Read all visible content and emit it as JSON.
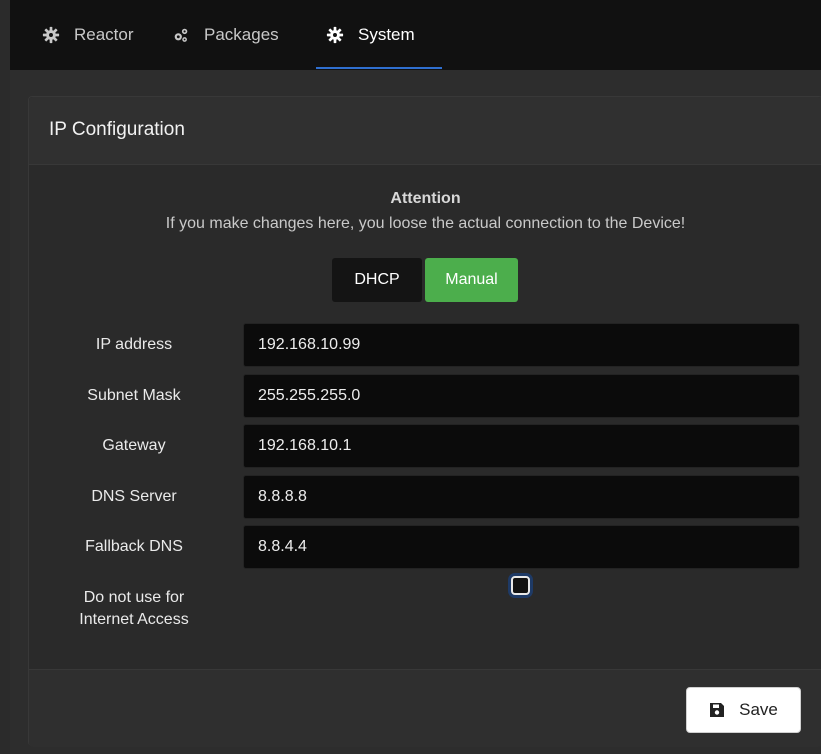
{
  "nav": {
    "tabs": [
      {
        "label": "Reactor",
        "icon": "cog-icon"
      },
      {
        "label": "Packages",
        "icon": "cogs-icon"
      },
      {
        "label": "System",
        "icon": "cog-icon",
        "active": true
      }
    ]
  },
  "card": {
    "title": "IP Configuration",
    "attention_title": "Attention",
    "attention_text": "If you make changes here, you loose the actual connection to the Device!",
    "mode_buttons": {
      "dhcp": "DHCP",
      "manual": "Manual",
      "selected": "Manual"
    },
    "fields": [
      {
        "label": "IP address",
        "value": "192.168.10.99"
      },
      {
        "label": "Subnet Mask",
        "value": "255.255.255.0"
      },
      {
        "label": "Gateway",
        "value": "192.168.10.1"
      },
      {
        "label": "DNS Server",
        "value": "8.8.8.8"
      },
      {
        "label": "Fallback DNS",
        "value": "8.8.4.4"
      }
    ],
    "no_internet_label_line1": "Do not use for",
    "no_internet_label_line2": "Internet Access",
    "no_internet_checked": false,
    "save_label": "Save"
  },
  "colors": {
    "accent": "#2f6fd0",
    "manual_active": "#4cae4c",
    "navbar_bg": "#111111",
    "page_bg": "#2b2b2b"
  }
}
